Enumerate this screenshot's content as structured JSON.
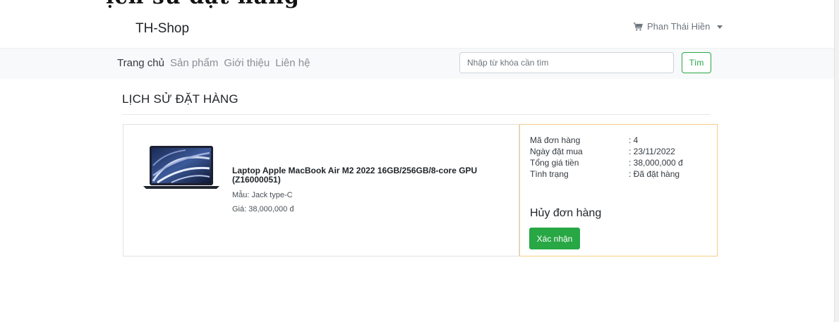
{
  "header": {
    "cropped_caption": "ịch sử đặt hàng",
    "brand": "TH-Shop",
    "user_name": "Phan Thái Hiền"
  },
  "nav": {
    "items": [
      "Trang chủ",
      "Sản phẩm",
      "Giới thiệu",
      "Liên hệ"
    ],
    "active_index": 0
  },
  "search": {
    "placeholder": "Nhập từ khóa cần tìm",
    "button_label": "Tìm"
  },
  "page": {
    "title": "LỊCH SỬ ĐẶT HÀNG"
  },
  "order": {
    "product_name": "Laptop Apple MacBook Air M2 2022 16GB/256GB/8-core GPU (Z16000051)",
    "color_text": "Mẫu: Jack type-C",
    "price_text": "Giá: 38,000,000 đ",
    "info": [
      {
        "label": "Mã đơn hàng",
        "value": ": 4"
      },
      {
        "label": "Ngày đặt mua",
        "value": ": 23/11/2022"
      },
      {
        "label": "Tổng giá tiền",
        "value": ": 38,000,000 đ"
      },
      {
        "label": "Tình trạng",
        "value": ": Đã đặt hàng"
      }
    ],
    "cancel_title": "Hủy đơn hàng",
    "confirm_label": "Xác nhận"
  },
  "colors": {
    "accent_green": "#28a745",
    "card_border_highlight": "#f6cd86",
    "navbar_bg": "#f8f9fa"
  },
  "icons": {
    "cart": "cart-icon",
    "caret": "caret-down-icon"
  }
}
